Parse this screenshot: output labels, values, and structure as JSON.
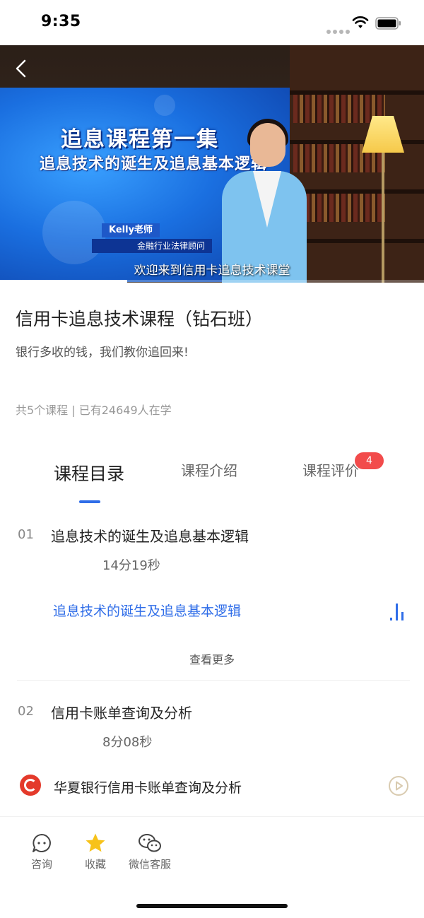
{
  "status_bar": {
    "time": "9:35"
  },
  "video": {
    "title_line1": "追息课程第一集",
    "title_line2": "追息技术的诞生及追息基本逻辑",
    "teacher_name": "Kelly老师",
    "teacher_role": "金融行业法律顾问",
    "subtitle": "欢迎来到信用卡追息技术课堂",
    "progress_fraction": 0.3
  },
  "course": {
    "title": "信用卡追息技术课程（钻石班）",
    "slogan": "银行多收的钱，我们教你追回来!",
    "stats": "共5个课程 | 已有24649人在学"
  },
  "tabs": [
    {
      "label": "课程目录",
      "active": true
    },
    {
      "label": "课程介绍",
      "active": false
    },
    {
      "label": "课程评价",
      "active": false,
      "badge": "4"
    }
  ],
  "lessons": [
    {
      "number": "01",
      "title": "追息技术的诞生及追息基本逻辑",
      "duration": "14分19秒",
      "items": [
        {
          "label": "追息技术的诞生及追息基本逻辑",
          "playing": true
        }
      ],
      "see_more": "查看更多"
    },
    {
      "number": "02",
      "title": "信用卡账单查询及分析",
      "duration": "8分08秒",
      "items": [
        {
          "label": "华夏银行信用卡账单查询及分析",
          "playing": false
        }
      ]
    }
  ],
  "bottom_bar": [
    {
      "label": "咨询",
      "icon": "chat-bubble-icon"
    },
    {
      "label": "收藏",
      "icon": "star-icon"
    },
    {
      "label": "微信客服",
      "icon": "wechat-icon"
    }
  ],
  "colors": {
    "accent": "#2f6de8",
    "badge": "#f24b4b",
    "star": "#f7c21a"
  }
}
